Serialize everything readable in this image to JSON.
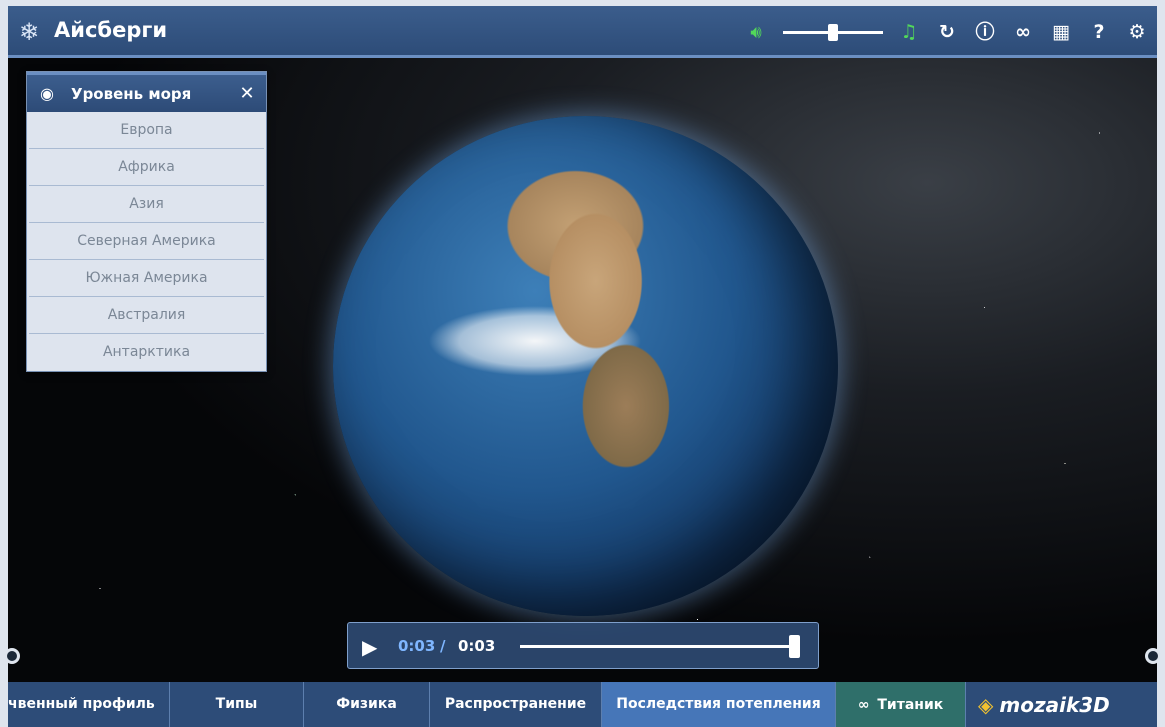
{
  "header": {
    "title": "Айсберги",
    "volume_level": 0.5
  },
  "panel": {
    "title": "Уровень моря",
    "regions": [
      "Европа",
      "Африка",
      "Азия",
      "Северная Америка",
      "Южная Америка",
      "Австралия",
      "Антарктика"
    ]
  },
  "player": {
    "current": "0:03",
    "separator": "/",
    "total": "0:03",
    "progress": 1.0
  },
  "tabs": [
    {
      "label": "чвенный профиль"
    },
    {
      "label": "Типы"
    },
    {
      "label": "Физика"
    },
    {
      "label": "Распространение"
    },
    {
      "label": "Последствия потепления"
    },
    {
      "label": "Титаник"
    }
  ],
  "brand": {
    "text": "mozaik3D"
  },
  "colors": {
    "header": "#2d4c78",
    "accent_green": "#52d85a",
    "active_tab": "#4676b8",
    "related_tab": "#2f6f6a",
    "time_current": "#7fb6ff"
  }
}
